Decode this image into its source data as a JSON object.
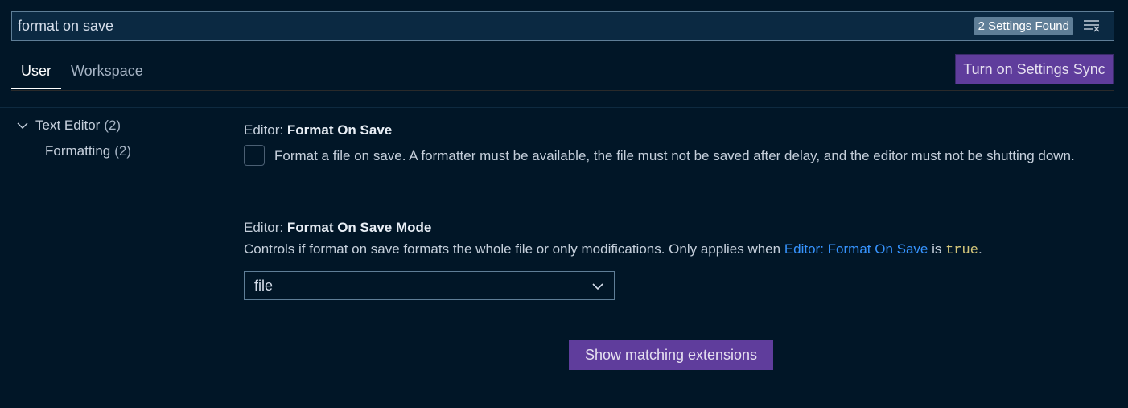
{
  "search": {
    "value": "format on save",
    "results_badge": "2 Settings Found",
    "clear_icon": "clear-filter-icon"
  },
  "tabs": [
    {
      "label": "User",
      "active": true
    },
    {
      "label": "Workspace",
      "active": false
    }
  ],
  "sync_button": "Turn on Settings Sync",
  "tree": [
    {
      "label": "Text Editor",
      "count": "(2)",
      "expanded": true
    },
    {
      "label": "Formatting",
      "count": "(2)"
    }
  ],
  "settings": [
    {
      "category": "Editor: ",
      "name": "Format On Save",
      "description": "Format a file on save. A formatter must be available, the file must not be saved after delay, and the editor must not be shutting down.",
      "checked": false
    },
    {
      "category": "Editor: ",
      "name": "Format On Save Mode",
      "description_pre": "Controls if format on save formats the whole file or only modifications. Only applies when ",
      "link": "Editor: Format On Save",
      "mid": " is ",
      "code": "true",
      "post": ".",
      "value": "file"
    }
  ],
  "extensions_button": "Show matching extensions",
  "colors": {
    "background": "#011627",
    "accent": "#5f3d9c",
    "link": "#3794ff"
  }
}
